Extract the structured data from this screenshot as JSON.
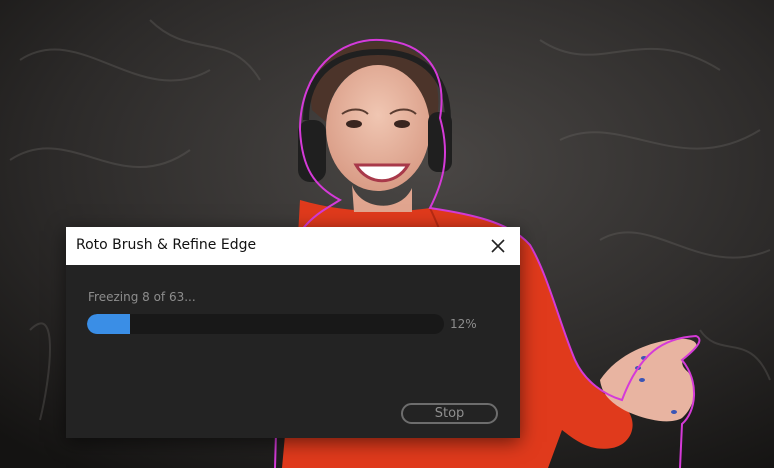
{
  "dialog": {
    "title": "Roto Brush & Refine Edge",
    "status": "Freezing 8 of 63...",
    "progress": {
      "fraction": 0.12,
      "label": "12%"
    },
    "stop_label": "Stop",
    "close_icon": "close-icon"
  },
  "colors": {
    "accent": "#3a8ee6",
    "roto_outline": "#d53ad8",
    "dialog_bg": "#232323",
    "sweater": "#e03a1c"
  }
}
